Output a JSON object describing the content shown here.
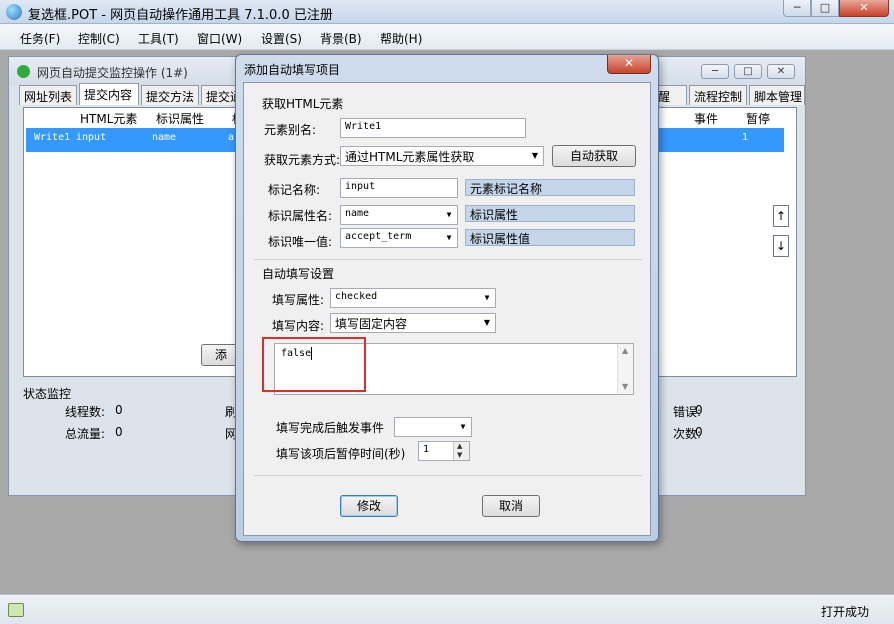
{
  "app": {
    "title": "复选框.POT  - 网页自动操作通用工具 7.1.0.0  已注册",
    "caption_buttons": {
      "minimize": "─",
      "maximize": "□",
      "close": "✕"
    }
  },
  "menu": {
    "items": [
      "任务(F)",
      "控制(C)",
      "工具(T)",
      "窗口(W)",
      "设置(S)",
      "背景(B)",
      "帮助(H)"
    ]
  },
  "child_window": {
    "title": "网页自动提交监控操作   (1#)",
    "tabs": [
      "网址列表",
      "提交内容",
      "提交方法",
      "提交通",
      "醒",
      "流程控制",
      "脚本管理"
    ],
    "active_tab_index": 1,
    "columns": [
      "HTML元素",
      "标识属性",
      "标",
      "事件",
      "暂停"
    ],
    "row": {
      "name": "Write1",
      "element": "input",
      "attr": "name",
      "value": "acc",
      "pause": "1"
    },
    "add_button_fragment": "添",
    "status_group_title": "状态监控",
    "status": {
      "threads_label": "线程数:",
      "threads_value": "0",
      "traffic_label": "总流量:",
      "traffic_value": "0",
      "col2a": "刷",
      "col2b": "网",
      "errors_label": "错误:",
      "errors_value": "0",
      "times_label": "次数:",
      "times_value": "0"
    },
    "arrows": {
      "up": "↑",
      "down": "↓"
    }
  },
  "dialog": {
    "title": "添加自动填写项目",
    "close_label": "✕",
    "group_get_element": "获取HTML元素",
    "alias_label": "元素别名:",
    "alias_value": "Write1",
    "method_label": "获取元素方式:",
    "method_value": "通过HTML元素属性获取",
    "auto_get_button": "自动获取",
    "tag_label": "标记名称:",
    "tag_value": "input",
    "tag_hint": "元素标记名称",
    "attr_name_label": "标识属性名:",
    "attr_name_value": "name",
    "attr_name_hint": "标识属性",
    "attr_value_label": "标识唯一值:",
    "attr_value_value": "accept_term",
    "attr_value_hint": "标识属性值",
    "group_autofill": "自动填写设置",
    "fill_attr_label": "填写属性:",
    "fill_attr_value": "checked",
    "fill_content_label": "填写内容:",
    "fill_content_value": "填写固定内容",
    "fill_text": "false",
    "trigger_label": "填写完成后触发事件",
    "trigger_value": "",
    "pause_label": "填写该项后暂停时间(秒)",
    "pause_value": "1",
    "modify_button": "修改",
    "cancel_button": "取消"
  },
  "statusbar": {
    "text": "打开成功"
  },
  "colors": {
    "selection": "#3399ff",
    "highlight_box": "#d9302b",
    "hint_fill": "#c5d6ea"
  }
}
